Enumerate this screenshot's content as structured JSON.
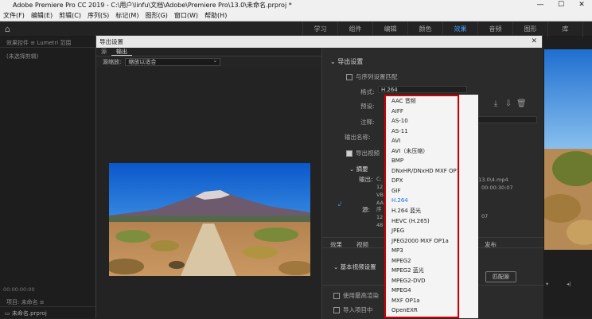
{
  "window": {
    "title": "Adobe Premiere Pro CC 2019 - C:\\用户\\linfu\\文档\\Adobe\\Premiere Pro\\13.0\\未命名.prproj *",
    "app_icon": "Pr",
    "controls": [
      "—",
      "☐",
      "✕"
    ]
  },
  "menu": [
    "文件(F)",
    "编辑(E)",
    "剪辑(C)",
    "序列(S)",
    "标记(M)",
    "图形(G)",
    "窗口(W)",
    "帮助(H)"
  ],
  "workspaces": {
    "tabs": [
      "学习",
      "组件",
      "编辑",
      "颜色",
      "效果",
      "音频",
      "图形",
      "库"
    ],
    "active": "效果",
    "overflow": "»"
  },
  "left_panel": {
    "tabs": "效果控件 ≡   Lumetri 范围",
    "no_clip": "(未选择剪辑)",
    "timecode": "00:00:00:00",
    "project_tab": "项目: 未命名 ≡",
    "project_file": "未命名.prproj"
  },
  "dialog": {
    "title": "导出设置",
    "tabs": [
      "源",
      "输出"
    ],
    "active_tab": "输出",
    "source_scaling_label": "源缩放:",
    "source_scaling_value": "缩放以适合",
    "export_settings": {
      "heading": "导出设置",
      "match_sequence": "与序列设置匹配",
      "format_label": "格式:",
      "format_value": "H.264",
      "preset_label": "预设:",
      "comment_label": "注释:",
      "output_name_label": "输出名称:",
      "export_video": "导出视频",
      "summary_heading": "摘要",
      "output_label": "输出:",
      "output_lines": [
        "C:",
        "12",
        "VB",
        "AA"
      ],
      "output_path_tail": "o\\13.0\\4.mp4",
      "output_duration": "00:00:30:07",
      "source_label": "源:",
      "source_lines": [
        "序",
        "12",
        "48"
      ],
      "source_tail": "07"
    },
    "bottom_tabs": [
      "效果",
      "视频",
      "发布"
    ],
    "basic_video_heading": "基本视频设置",
    "match_source_btn": "匹配源",
    "use_max_render": "使用最高渲染",
    "import_into_project": "导入项目中"
  },
  "format_dropdown": {
    "items": [
      "AAC 音频",
      "AIFF",
      "AS-10",
      "AS-11",
      "AVI",
      "AVI（未压缩）",
      "BMP",
      "DNxHR/DNxHD MXF OP1a",
      "DPX",
      "GIF",
      "H.264",
      "H.264 蓝光",
      "HEVC (H.265)",
      "JPEG",
      "JPEG2000 MXF OP1a",
      "MP3",
      "MPEG2",
      "MPEG2 蓝光",
      "MPEG2-DVD",
      "MPEG4",
      "MXF OP1a",
      "OpenEXR"
    ],
    "selected": "H.264",
    "highlight_color": "#d00000"
  }
}
